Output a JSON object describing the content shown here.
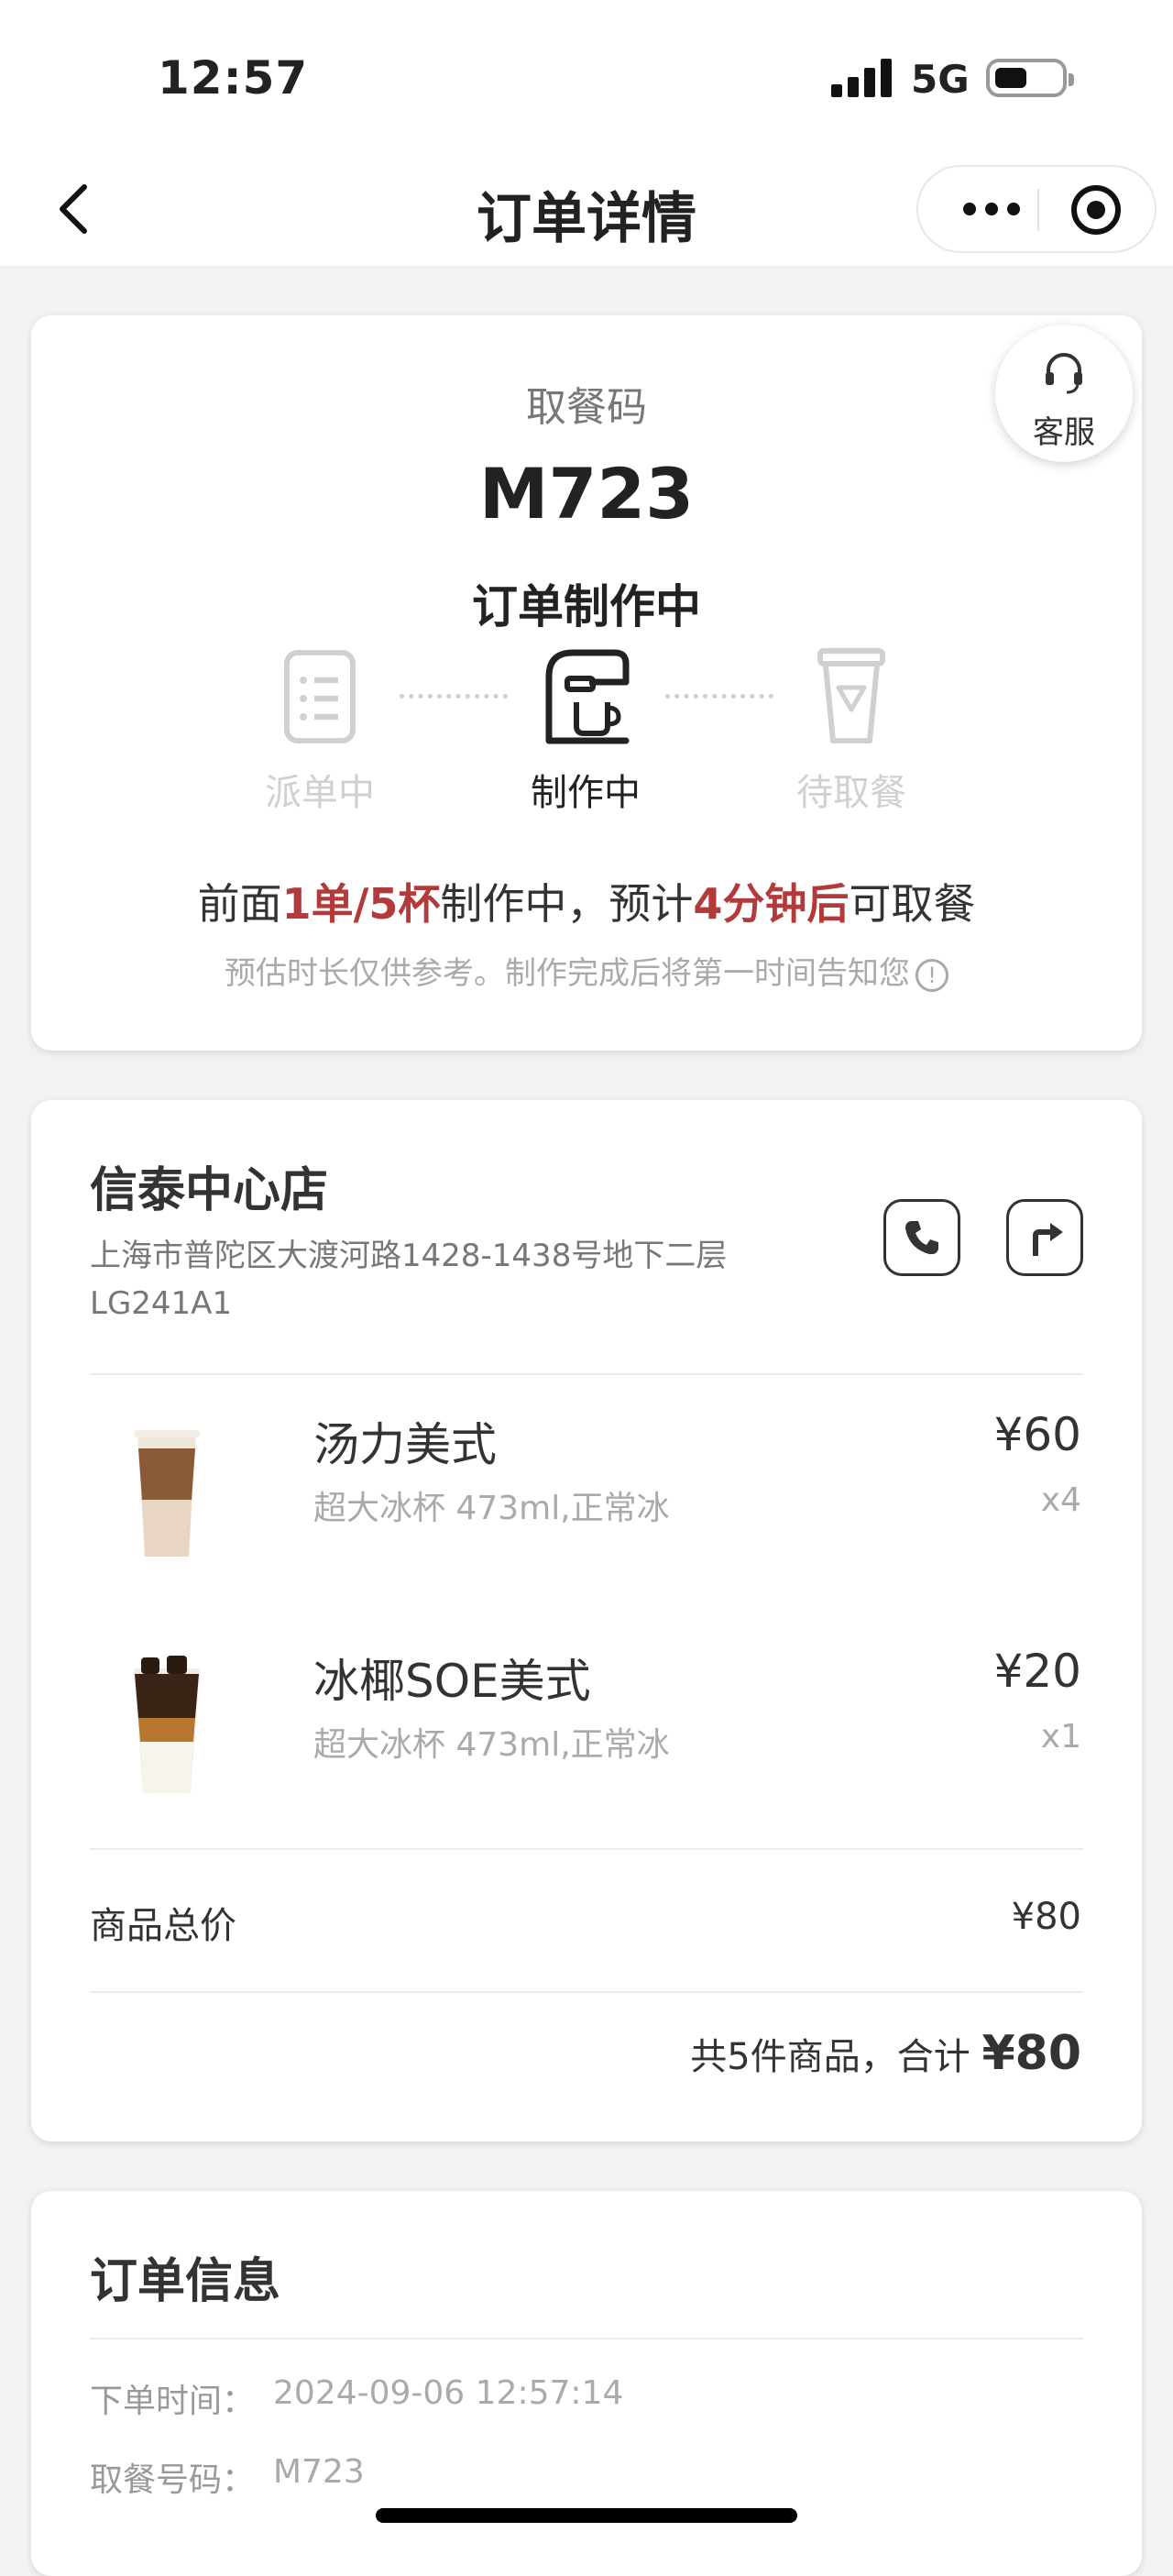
{
  "status_bar": {
    "time": "12:57",
    "network": "5G"
  },
  "navbar": {
    "title": "订单详情"
  },
  "pickup": {
    "label": "取餐码",
    "code": "M723",
    "status": "订单制作中",
    "customer_service": "客服",
    "steps": [
      {
        "label": "派单中",
        "icon": "receipt-icon",
        "state": "done"
      },
      {
        "label": "制作中",
        "icon": "coffee-machine-icon",
        "state": "active"
      },
      {
        "label": "待取餐",
        "icon": "cup-icon",
        "state": "pending"
      }
    ],
    "eta": {
      "prefix": "前面",
      "queue": "1单/5杯",
      "middle": "制作中，预计",
      "time": "4分钟后",
      "suffix": "可取餐"
    },
    "note": "预估时长仅供参考。制作完成后将第一时间告知您",
    "accent_color": "#b33a3a"
  },
  "store": {
    "name": "信泰中心店",
    "address": "上海市普陀区大渡河路1428-1438号地下二层LG241A1"
  },
  "items": [
    {
      "name": "汤力美式",
      "spec": "超大冰杯 473ml,正常冰",
      "price": "¥60",
      "qty": "x4"
    },
    {
      "name": "冰椰SOE美式",
      "spec": "超大冰杯 473ml,正常冰",
      "price": "¥20",
      "qty": "x1"
    }
  ],
  "summary": {
    "subtotal_label": "商品总价",
    "subtotal_value": "¥80",
    "total_prefix": "共5件商品，合计",
    "total_value": "¥80"
  },
  "order_info": {
    "title": "订单信息",
    "rows": [
      {
        "label": "下单时间：",
        "value": "2024-09-06 12:57:14"
      },
      {
        "label": "取餐号码：",
        "value": "M723"
      }
    ]
  }
}
